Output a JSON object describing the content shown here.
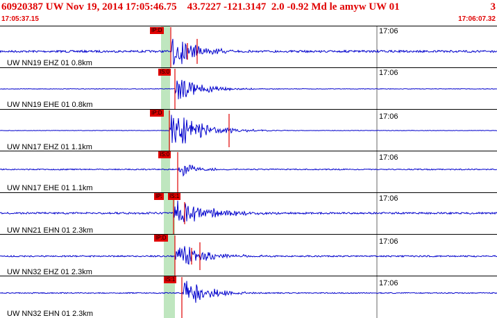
{
  "header": {
    "title": "60920387 UW Nov 19, 2014 17:05:46.75    43.7227 -121.3147  2.0 -0.92 Md le amyw UW 01",
    "page_number": "3",
    "start_time": "17:05:37.15",
    "end_time": "17:06:07.32"
  },
  "minute_label": "17:06",
  "colors": {
    "trace": "#0000cc",
    "pick": "#e00000",
    "window": "#bfe6bf",
    "text": "#000000",
    "header": "#e00000"
  },
  "traces": [
    {
      "label": "UW NN19 EHZ 01 0.8km",
      "picks": [
        "IP:D"
      ]
    },
    {
      "label": "UW NN19 EHE 01 0.8km",
      "picks": [
        "IS:0"
      ]
    },
    {
      "label": "UW NN17 EHZ 01 1.1km",
      "picks": [
        "IP:D"
      ]
    },
    {
      "label": "UW NN17 EHE 01 1.1km",
      "picks": [
        "IS:0"
      ]
    },
    {
      "label": "UW NN21 EHN 01 2.3km",
      "picks": [
        "IP:",
        "IS:1"
      ]
    },
    {
      "label": "UW NN32 EHZ 01 2.3km",
      "picks": [
        "IP:D"
      ]
    },
    {
      "label": "UW NN32 EHN 01 2.3km",
      "picks": [
        "IS:1"
      ]
    }
  ]
}
